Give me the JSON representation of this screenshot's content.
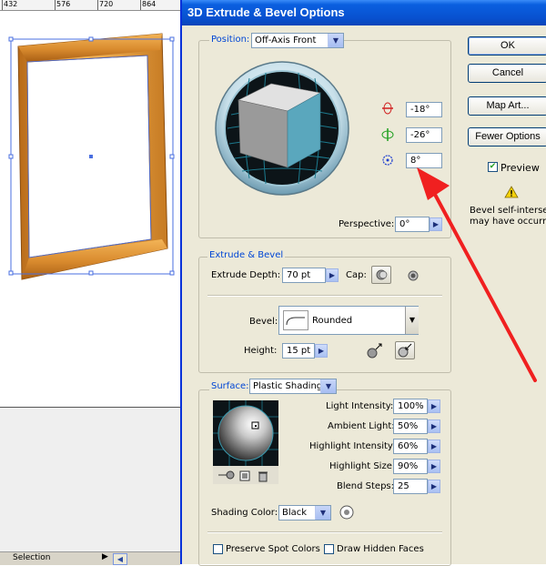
{
  "ruler": {
    "marks": [
      "432",
      "576",
      "720",
      "864"
    ]
  },
  "status_bar": {
    "label": "Selection",
    "arrow": "▶",
    "scroll": "◀"
  },
  "dialog": {
    "title": "3D Extrude & Bevel Options",
    "position": {
      "label": "Position:",
      "selected": "Off-Axis Front",
      "x_rotation": "-18°",
      "y_rotation": "-26°",
      "z_rotation": "8°",
      "perspective_label": "Perspective:",
      "perspective_value": "0°"
    },
    "buttons": {
      "ok": "OK",
      "cancel": "Cancel",
      "map_art": "Map Art...",
      "fewer_options": "Fewer Options"
    },
    "preview": {
      "label": "Preview",
      "checked": true
    },
    "warning": {
      "icon": "warning-icon",
      "text": "Bevel self-intersection\nmay have occurred"
    },
    "extrude": {
      "group_label": "Extrude & Bevel",
      "depth_label": "Extrude Depth:",
      "depth_value": "70 pt",
      "cap_label": "Cap:",
      "bevel_label": "Bevel:",
      "bevel_value": "Rounded",
      "height_label": "Height:",
      "height_value": "15 pt"
    },
    "surface": {
      "label": "Surface:",
      "selected": "Plastic Shading",
      "light_intensity_label": "Light Intensity:",
      "light_intensity": "100%",
      "ambient_light_label": "Ambient Light:",
      "ambient_light": "50%",
      "highlight_intensity_label": "Highlight Intensity:",
      "highlight_intensity": "60%",
      "highlight_size_label": "Highlight Size:",
      "highlight_size": "90%",
      "blend_steps_label": "Blend Steps:",
      "blend_steps": "25",
      "shading_color_label": "Shading Color:",
      "shading_color": "Black",
      "preserve_spot_label": "Preserve Spot Colors",
      "draw_hidden_label": "Draw Hidden Faces"
    }
  },
  "colors": {
    "titlebar": "#0851d0",
    "dialog_bg": "#ece9d8",
    "group_label": "#0046d5",
    "frame_orange": "#e29a3a",
    "annotation_arrow": "#f02020"
  }
}
